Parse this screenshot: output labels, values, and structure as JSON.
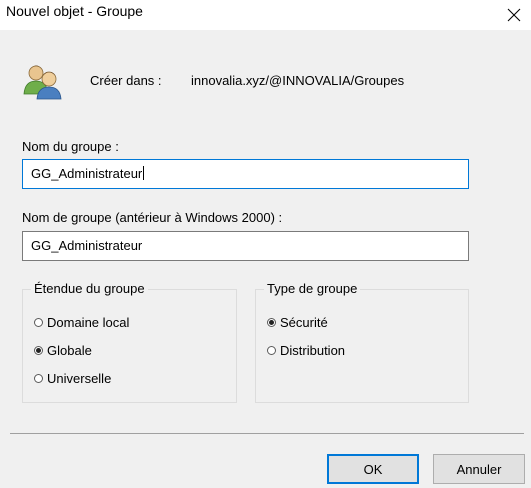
{
  "window": {
    "title": "Nouvel objet - Groupe",
    "close_glyph": "✕"
  },
  "header": {
    "icon": "users-group-icon",
    "create_in_label": "Créer dans :",
    "create_in_path": "innovalia.xyz/@INNOVALIA/Groupes"
  },
  "form": {
    "group_name_label": "Nom du groupe :",
    "group_name_value": "GG_Administrateur",
    "group_name_pre2000_label": "Nom de groupe (antérieur à Windows 2000) :",
    "group_name_pre2000_value": "GG_Administrateur"
  },
  "scope": {
    "legend": "Étendue du groupe",
    "options": [
      {
        "label": "Domaine local",
        "selected": false
      },
      {
        "label": "Globale",
        "selected": true
      },
      {
        "label": "Universelle",
        "selected": false
      }
    ]
  },
  "type": {
    "legend": "Type de groupe",
    "options": [
      {
        "label": "Sécurité",
        "selected": true
      },
      {
        "label": "Distribution",
        "selected": false
      }
    ]
  },
  "buttons": {
    "ok": "OK",
    "cancel": "Annuler"
  },
  "colors": {
    "focus_border": "#0078d7",
    "dialog_bg": "#f0f0f0"
  }
}
